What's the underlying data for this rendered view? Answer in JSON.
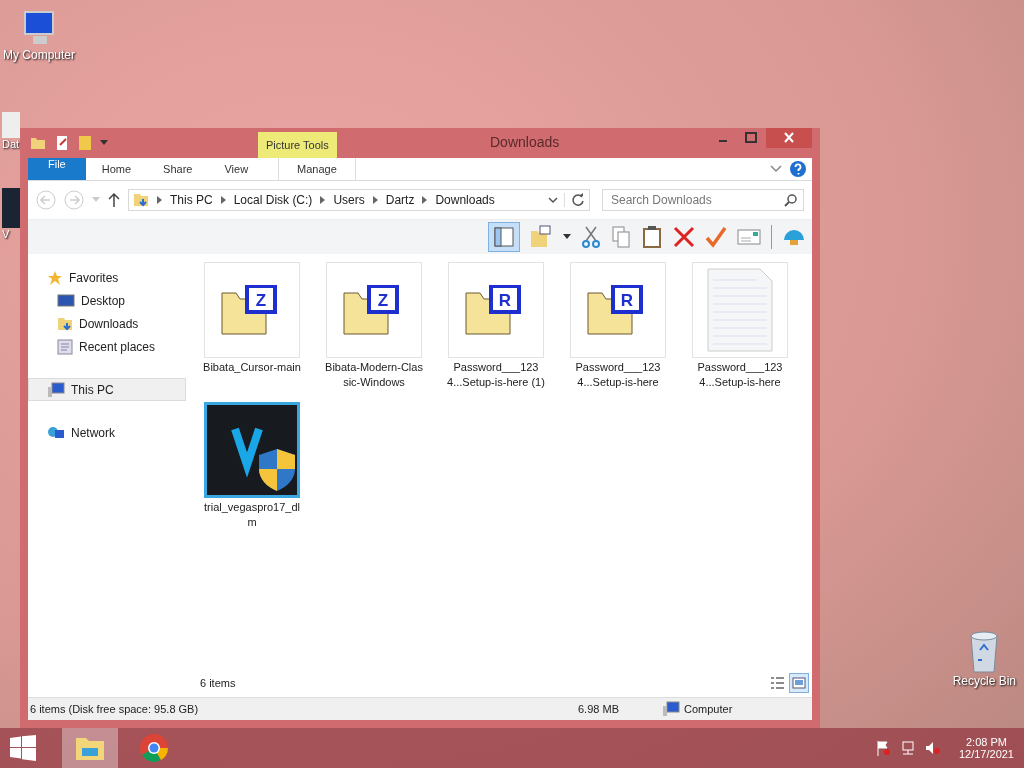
{
  "desktop_icons": [
    {
      "label": "My Computer",
      "kind": "computer"
    },
    {
      "label": "Dat",
      "kind": "file"
    },
    {
      "label": "V",
      "kind": "app"
    }
  ],
  "recycle_bin": {
    "label": "Recycle Bin"
  },
  "window": {
    "title": "Downloads",
    "context_tab": "Picture Tools",
    "ribbon_tabs": [
      {
        "label": "File",
        "kind": "file"
      },
      {
        "label": "Home",
        "kind": "tab"
      },
      {
        "label": "Share",
        "kind": "tab"
      },
      {
        "label": "View",
        "kind": "tab"
      },
      {
        "label": "Manage",
        "kind": "context"
      }
    ],
    "address": [
      "This PC",
      "Local Disk (C:)",
      "Users",
      "Dartz",
      "Downloads"
    ],
    "search": {
      "placeholder": "Search Downloads"
    },
    "preview_pane": {
      "on": true
    },
    "navigation": [
      {
        "label": "Favorites",
        "kind": "favorites",
        "selected": false,
        "children": [
          {
            "label": "Desktop",
            "kind": "desktop",
            "selected": false
          },
          {
            "label": "Downloads",
            "kind": "downloads",
            "selected": false
          },
          {
            "label": "Recent places",
            "kind": "recent",
            "selected": false
          }
        ]
      },
      {
        "label": "This PC",
        "kind": "pc",
        "selected": true
      },
      {
        "label": "Network",
        "kind": "network",
        "selected": false
      }
    ],
    "files": [
      {
        "name": "Bibata_Cursor-main",
        "kind": "zip",
        "badge": "Z"
      },
      {
        "name": "Bibata-Modern-Classic-Windows",
        "kind": "zip",
        "badge": "Z"
      },
      {
        "name": "Password___1234...Setup-is-here (1)",
        "kind": "rar",
        "badge": "R"
      },
      {
        "name": "Password___1234...Setup-is-here",
        "kind": "rar",
        "badge": "R"
      },
      {
        "name": "Password___1234...Setup-is-here",
        "kind": "text"
      },
      {
        "name": "trial_vegaspro17_dlm",
        "kind": "app"
      }
    ],
    "item_count": "6 items",
    "views": [
      {
        "kind": "details",
        "selected": false
      },
      {
        "kind": "large",
        "selected": true
      }
    ],
    "status_bar": {
      "summary": "6 items (Disk free space: 95.8 GB)",
      "size": "6.98 MB",
      "location": "Computer"
    }
  },
  "taskbar": {
    "apps": [
      {
        "kind": "explorer",
        "selected": true
      },
      {
        "kind": "chrome",
        "selected": false
      }
    ],
    "time": "2:08 PM",
    "date": "12/17/2021"
  }
}
